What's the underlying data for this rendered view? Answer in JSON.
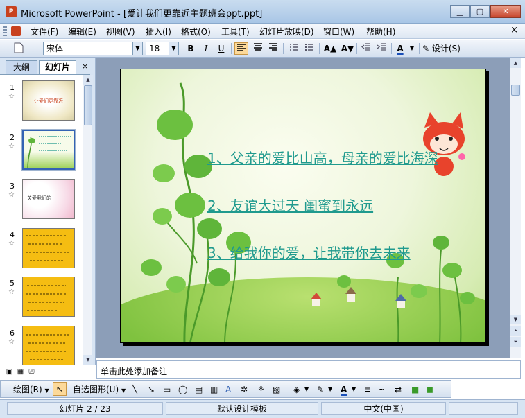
{
  "window": {
    "title": "Microsoft PowerPoint - [爱让我们更靠近主题班会ppt.ppt]",
    "minimize": "▁",
    "maximize": "▢",
    "close": "✕"
  },
  "menu": {
    "items": [
      "文件(F)",
      "编辑(E)",
      "视图(V)",
      "插入(I)",
      "格式(O)",
      "工具(T)",
      "幻灯片放映(D)",
      "窗口(W)",
      "帮助(H)"
    ],
    "close": "×"
  },
  "toolbar": {
    "font_name": "宋体",
    "font_size": "18",
    "bold": "B",
    "italic": "I",
    "underline": "U",
    "font_grow": "A▲",
    "font_shrink": "A▼",
    "font_color": "A",
    "design_label": "设计(S)"
  },
  "left_pane": {
    "tab_outline": "大纲",
    "tab_slides": "幻灯片",
    "close": "×",
    "thumbnails": [
      {
        "num": "1",
        "caption": "让爱们更靠近"
      },
      {
        "num": "2",
        "caption": ""
      },
      {
        "num": "3",
        "caption": "关爱我们的"
      },
      {
        "num": "4",
        "caption": ""
      },
      {
        "num": "5",
        "caption": ""
      },
      {
        "num": "6",
        "caption": ""
      }
    ]
  },
  "slide": {
    "line1": "1、父亲的爱比山高，母亲的爱比海深",
    "line2": "2、友谊大过天 闺蜜到永远",
    "line3": "3、给我你的爱，让我带你去未来"
  },
  "notes": {
    "placeholder": "单击此处添加备注"
  },
  "draw_toolbar": {
    "draw_label": "绘图(R)",
    "autoshape_label": "自选图形(U)"
  },
  "status": {
    "slide_pos": "幻灯片 2 / 23",
    "template": "默认设计模板",
    "language": "中文(中国)"
  }
}
